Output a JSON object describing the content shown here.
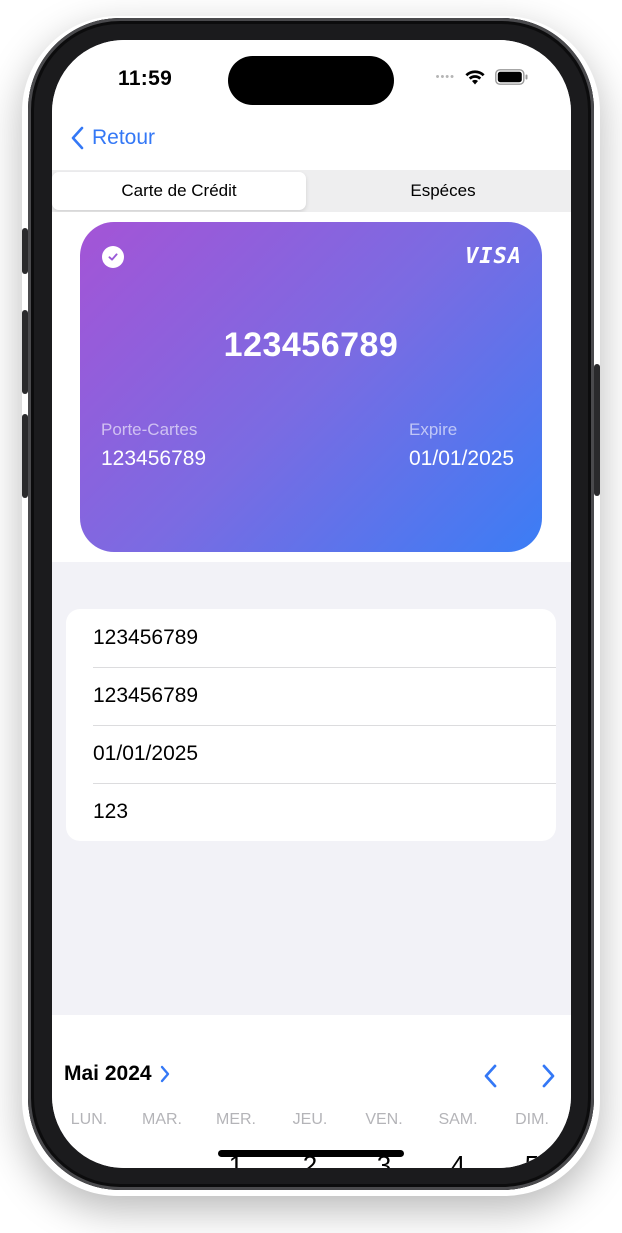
{
  "status": {
    "time": "11:59"
  },
  "nav": {
    "back_label": "Retour"
  },
  "tabs": [
    {
      "label": "Carte de Crédit",
      "active": true
    },
    {
      "label": "Espéces",
      "active": false
    }
  ],
  "card": {
    "brand": "VISA",
    "number": "123456789",
    "holder_label": "Porte-Cartes",
    "holder_value": "123456789",
    "expiry_label": "Expire",
    "expiry_value": "01/01/2025",
    "gradient": [
      "#a454d6",
      "#3b7df5"
    ]
  },
  "form": {
    "rows": [
      {
        "value": "123456789"
      },
      {
        "value": "123456789"
      },
      {
        "value": "01/01/2025"
      },
      {
        "value": "123"
      }
    ]
  },
  "calendar": {
    "month_label": "Mai 2024",
    "weekdays": [
      "LUN.",
      "MAR.",
      "MER.",
      "JEU.",
      "VEN.",
      "SAM.",
      "DIM."
    ],
    "days": [
      "1",
      "2",
      "3",
      "4",
      "5"
    ]
  },
  "colors": {
    "accent": "#3478f6",
    "background": "#f2f2f7"
  }
}
